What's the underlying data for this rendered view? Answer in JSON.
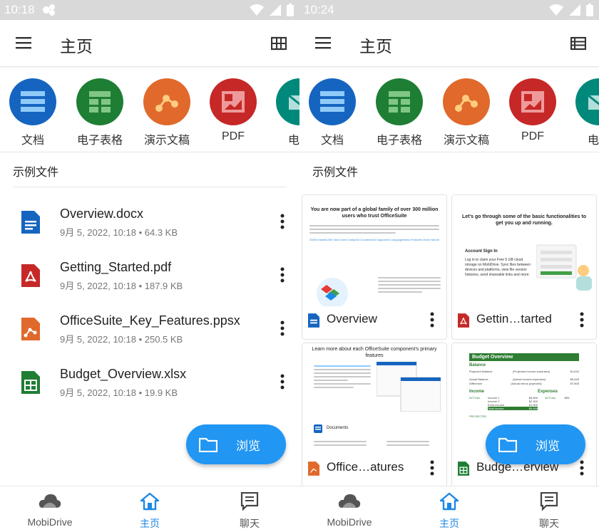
{
  "left": {
    "status_time": "10:18",
    "title": "主页",
    "categories": [
      "文档",
      "电子表格",
      "演示文稿",
      "PDF",
      "电子"
    ],
    "section_title": "示例文件",
    "files": [
      {
        "name": "Overview.docx",
        "meta": "9月 5, 2022, 10:18 • 64.3 KB",
        "type": "doc"
      },
      {
        "name": "Getting_Started.pdf",
        "meta": "9月 5, 2022, 10:18 • 187.9 KB",
        "type": "pdf"
      },
      {
        "name": "OfficeSuite_Key_Features.ppsx",
        "meta": "9月 5, 2022, 10:18 • 250.5 KB",
        "type": "ppt"
      },
      {
        "name": "Budget_Overview.xlsx",
        "meta": "9月 5, 2022, 10:18 • 19.9 KB",
        "type": "xls"
      }
    ],
    "fab_label": "浏览",
    "nav": [
      "MobiDrive",
      "主页",
      "聊天"
    ]
  },
  "right": {
    "status_time": "10:24",
    "title": "主页",
    "categories": [
      "文档",
      "电子表格",
      "演示文稿",
      "PDF",
      "电子"
    ],
    "section_title": "示例文件",
    "cards": [
      {
        "name": "Overview",
        "type": "doc"
      },
      {
        "name": "Gettin…tarted",
        "type": "pdf"
      },
      {
        "name": "Office…atures",
        "type": "ppt"
      },
      {
        "name": "Budge…erview",
        "type": "xls"
      }
    ],
    "thumbs": {
      "overview_title": "You are now part of a global family of over 300 million users who trust OfficeSuite",
      "overview_stats": [
        "200M Installs",
        "100K New Users Daily",
        "100 Countries",
        "50 Supported Languages",
        "New Features Every Month"
      ],
      "getting_title": "Let's go through some of the basic functionalities to get you up and running.",
      "getting_sub": "Account Sign In",
      "getting_text": "Log in to claim your Free 5 GB cloud storage on MobiDrive. Sync files between devices and platforms, view file version histories, send shareable links and more.",
      "features_title": "Learn more about each OfficeSuite component's primary features",
      "features_sub": "Documents",
      "budget_title": "Budget Overview",
      "budget_balance": "Balance",
      "budget_income": "Income",
      "budget_expenses": "Expenses",
      "budget_actual": "ACTUAL",
      "budget_projected": "PROJECTED",
      "budget_rows": [
        {
          "label": "Projected Balance",
          "note": "(Projected income-expenses)",
          "value": "$1,640"
        },
        {
          "label": "Actual Balance",
          "note": "(Actual income-expenses)",
          "value": "$5,645"
        },
        {
          "label": "Difference",
          "note": "(Actual minus projected)",
          "value": "$7,805"
        }
      ],
      "budget_income_rows": [
        {
          "label": "Income 1",
          "value": "$5,800"
        },
        {
          "label": "Income 2",
          "value": "$2,300"
        },
        {
          "label": "Extra income",
          "value": "$1,500"
        },
        {
          "label": "Total income",
          "value": "$9,699"
        }
      ],
      "budget_expense_value": "$55"
    },
    "fab_label": "浏览",
    "nav": [
      "MobiDrive",
      "主页",
      "聊天"
    ]
  },
  "colors": {
    "doc": "#1565c0",
    "xls": "#1e7e34",
    "ppt": "#e0692b",
    "pdf": "#c62828",
    "accent": "#2196f3",
    "nav_active": "#1e88e5"
  },
  "icons": [
    "menu-icon",
    "grid-view-icon",
    "list-view-icon",
    "folder-icon",
    "cloud-icon",
    "home-icon",
    "chat-icon",
    "more-vert-icon",
    "wifi-icon",
    "signal-icon",
    "battery-icon"
  ]
}
